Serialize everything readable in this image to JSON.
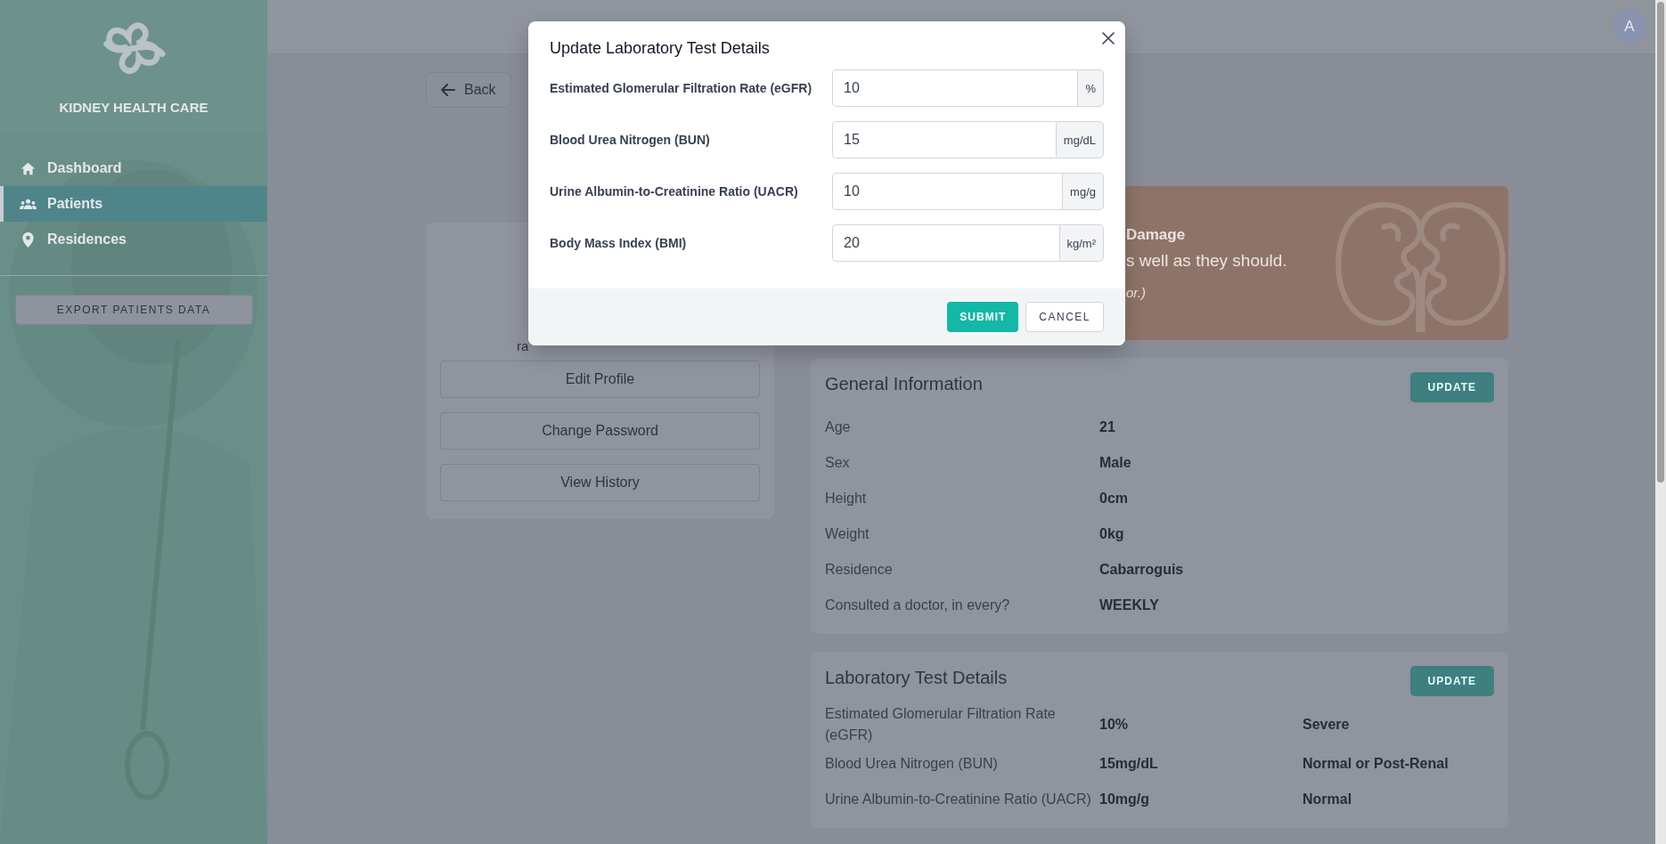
{
  "sidebar": {
    "brand": "KIDNEY HEALTH CARE",
    "items": [
      {
        "label": "Dashboard",
        "selected": false
      },
      {
        "label": "Patients",
        "selected": true
      },
      {
        "label": "Residences",
        "selected": false
      }
    ],
    "export_button": "EXPORT PATIENTS DATA"
  },
  "topbar": {
    "avatar": "A"
  },
  "page": {
    "back": "Back"
  },
  "profile_card": {
    "name": "ra",
    "buttons": [
      "Edit Profile",
      "Change Password",
      "View History"
    ]
  },
  "alert_banner": {
    "heading": "Damage",
    "text": "s well as they should.",
    "note": "or.)"
  },
  "general_info": {
    "title": "General Information",
    "update_button": "UPDATE",
    "rows": [
      {
        "label": "Age",
        "value": "21"
      },
      {
        "label": "Sex",
        "value": "Male"
      },
      {
        "label": "Height",
        "value": "0cm"
      },
      {
        "label": "Weight",
        "value": "0kg"
      },
      {
        "label": "Residence",
        "value": "Cabarroguis"
      },
      {
        "label": "Consulted a doctor, in every?",
        "value": "WEEKLY"
      }
    ]
  },
  "lab_details": {
    "title": "Laboratory Test Details",
    "update_button": "UPDATE",
    "rows": [
      {
        "label": "Estimated Glomerular Filtration Rate (eGFR)",
        "value": "10%",
        "status": "Severe"
      },
      {
        "label": "Blood Urea Nitrogen (BUN)",
        "value": "15mg/dL",
        "status": "Normal or Post-Renal"
      },
      {
        "label": "Urine Albumin-to-Creatinine Ratio (UACR)",
        "value": "10mg/g",
        "status": "Normal"
      }
    ]
  },
  "modal": {
    "title": "Update Laboratory Test Details",
    "fields": [
      {
        "label": "Estimated Glomerular Filtration Rate (eGFR)",
        "value": "10",
        "unit": "%"
      },
      {
        "label": "Blood Urea Nitrogen (BUN)",
        "value": "15",
        "unit": "mg/dL"
      },
      {
        "label": "Urine Albumin-to-Creatinine Ratio (UACR)",
        "value": "10",
        "unit": "mg/g"
      },
      {
        "label": "Body Mass Index (BMI)",
        "value": "20",
        "unit": "kg/m²"
      }
    ],
    "submit_button": "SUBMIT",
    "cancel_button": "CANCEL"
  }
}
